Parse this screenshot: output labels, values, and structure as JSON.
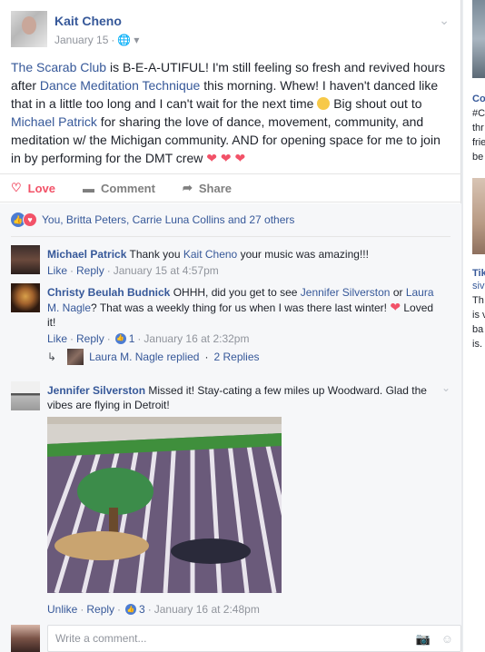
{
  "post": {
    "author": "Kait Cheno",
    "date": "January 15",
    "privacy_icon": "globe-icon",
    "text": {
      "link1": "The Scarab Club",
      "t1": " is B-E-A-UTIFUL! I'm still feeling so fresh and revived hours after ",
      "link2": "Dance Meditation Technique",
      "t2": " this morning. Whew! I haven't danced like that in a little too long and I can't wait for the next time ",
      "t3": " Big shout out to ",
      "link3": "Michael Patrick",
      "t4": " for sharing the love of dance, movement, community, and meditation w/ the Michigan community. AND for opening space for me to join in by performing for the DMT crew ",
      "hearts": "❤ ❤ ❤"
    },
    "actions": {
      "love": "Love",
      "comment": "Comment",
      "share": "Share"
    },
    "reactions_summary": "You, Britta Peters, Carrie Luna Collins and 27 others"
  },
  "comments": [
    {
      "author": "Michael Patrick",
      "text_before": " Thank you ",
      "mention": "Kait Cheno",
      "text_after": " your music was amazing!!!",
      "like": "Like",
      "reply": "Reply",
      "time": "January 15 at 4:57pm"
    },
    {
      "author": "Christy Beulah Budnick",
      "text_before": " OHHH, did you get to see ",
      "mention1": "Jennifer Silverston",
      "text_mid": " or ",
      "mention2": "Laura M. Nagle",
      "text_after": "? That was a weekly thing for us when I was there last winter! ",
      "text_end": " Loved it!",
      "like": "Like",
      "reply": "Reply",
      "like_count": "1",
      "time": "January 16 at 2:32pm",
      "replies": {
        "author": "Laura M. Nagle",
        "replied": "Laura M. Nagle replied",
        "count": "2 Replies"
      }
    },
    {
      "author": "Jennifer Silverston",
      "text": " Missed it! Stay-cating a few miles up Woodward. Glad the vibes are flying in Detroit!",
      "unlike": "Unlike",
      "reply": "Reply",
      "like_count": "3",
      "time": "January 16 at 2:48pm"
    }
  ],
  "write_comment": {
    "placeholder": "Write a comment..."
  },
  "right_column": {
    "item1_title": "Co",
    "item1_lines": [
      "#C",
      "thr",
      "frie",
      "be"
    ],
    "item2_title": "Tik",
    "item2_lines": [
      "siv",
      "Th",
      "is v",
      "ba",
      "is."
    ]
  },
  "colors": {
    "link": "#365899",
    "love": "#f25268",
    "like": "#4c7cd2",
    "meta": "#90949c"
  }
}
